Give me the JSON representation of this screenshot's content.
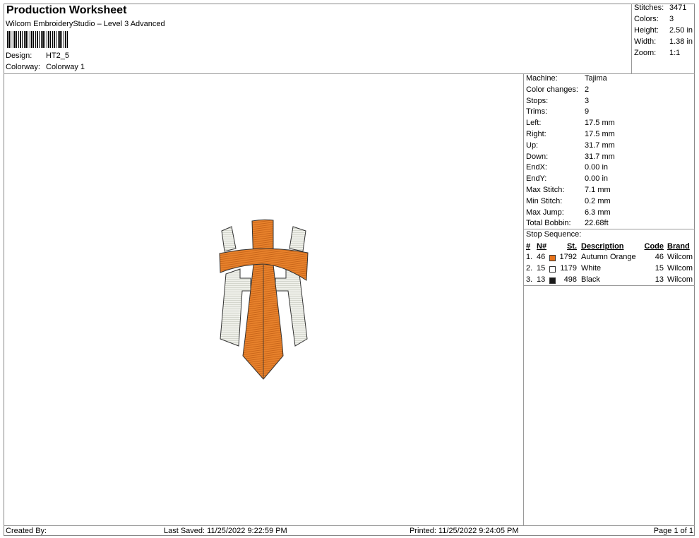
{
  "header": {
    "title": "Production Worksheet",
    "subtitle": "Wilcom EmbroideryStudio – Level 3 Advanced",
    "design_label": "Design:",
    "design": "HT2_5",
    "colorway_label": "Colorway:",
    "colorway": "Colorway 1"
  },
  "summary": [
    {
      "label": "Stitches:",
      "value": "3471"
    },
    {
      "label": "Colors:",
      "value": "3"
    },
    {
      "label": "Height:",
      "value": "2.50 in"
    },
    {
      "label": "Width:",
      "value": "1.38 in"
    },
    {
      "label": "Zoom:",
      "value": "1:1"
    }
  ],
  "details": [
    {
      "label": "Machine:",
      "value": "Tajima"
    },
    {
      "label": "Color changes:",
      "value": "2"
    },
    {
      "label": "Stops:",
      "value": "3"
    },
    {
      "label": "Trims:",
      "value": "9"
    },
    {
      "label": "Left:",
      "value": "17.5 mm"
    },
    {
      "label": "Right:",
      "value": "17.5 mm"
    },
    {
      "label": "Up:",
      "value": "31.7 mm"
    },
    {
      "label": "Down:",
      "value": "31.7 mm"
    },
    {
      "label": "EndX:",
      "value": "0.00 in"
    },
    {
      "label": "EndY:",
      "value": "0.00 in"
    },
    {
      "label": "Max Stitch:",
      "value": "7.1 mm"
    },
    {
      "label": "Min Stitch:",
      "value": "0.2 mm"
    },
    {
      "label": "Max Jump:",
      "value": "6.3 mm"
    },
    {
      "label": "Total Bobbin:",
      "value": "22.68ft"
    }
  ],
  "stop_sequence": {
    "title": "Stop Sequence:",
    "headers": {
      "idx": "#",
      "n": "N#",
      "st": "St.",
      "desc": "Description",
      "code": "Code",
      "brand": "Brand"
    },
    "rows": [
      {
        "idx": "1.",
        "n": "46",
        "color": "#e8731a",
        "st": "1792",
        "desc": "Autumn Orange",
        "code": "46",
        "brand": "Wilcom"
      },
      {
        "idx": "2.",
        "n": "15",
        "color": "#ffffff",
        "st": "1179",
        "desc": "White",
        "code": "15",
        "brand": "Wilcom"
      },
      {
        "idx": "3.",
        "n": "13",
        "color": "#1a1a1a",
        "st": "498",
        "desc": "Black",
        "code": "13",
        "brand": "Wilcom"
      }
    ]
  },
  "footer": {
    "created": "Created By:",
    "saved": "Last Saved: 11/25/2022 9:22:59 PM",
    "printed": "Printed: 11/25/2022 9:24:05 PM",
    "page": "Page 1 of 1"
  }
}
